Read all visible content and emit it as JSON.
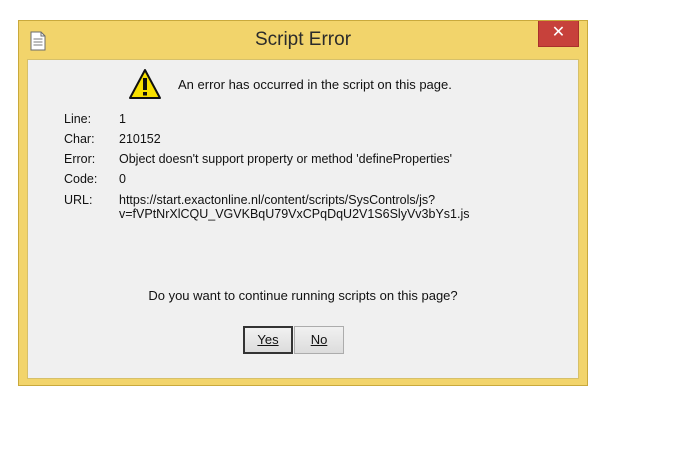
{
  "window": {
    "title": "Script Error",
    "close_label": "✕"
  },
  "message": {
    "headline": "An error has occurred in the script on this page."
  },
  "details": [
    {
      "label": "Line:",
      "value": "1"
    },
    {
      "label": "Char:",
      "value": "210152"
    },
    {
      "label": "Error:",
      "value": "Object doesn't support property or method 'defineProperties'"
    },
    {
      "label": "Code:",
      "value": "0"
    },
    {
      "label": "URL:",
      "value_lines": [
        "https://start.exactonline.nl/content/scripts/SysControls/js?",
        "v=fVPtNrXlCQU_VGVKBqU79VxCPqDqU2V1S6SlyVv3bYs1.js"
      ]
    }
  ],
  "prompt": {
    "question": "Do you want to continue running scripts on this page?"
  },
  "buttons": {
    "yes_label": "Yes",
    "no_label": "No"
  },
  "icons": {
    "title_icon": "document-icon",
    "warning_icon": "warning-icon",
    "close_icon": "close-icon"
  },
  "colors": {
    "frame": "#f2d46b",
    "close": "#c7413b",
    "client": "#f0f0f0"
  }
}
